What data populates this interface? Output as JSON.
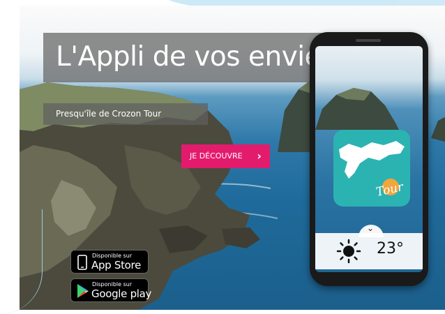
{
  "hero": {
    "headline": "L'Appli de vos envies !",
    "subtitle": "Presqu'île de Crozon Tour",
    "cta_label": "JE DÉCOUVRE",
    "cta_chevron": "›"
  },
  "phone": {
    "app_tile_text": "Tour",
    "temperature": "23°",
    "handle_glyph": "⌄"
  },
  "stores": {
    "apple_small": "Disponible sur",
    "apple_big": "App Store",
    "google_small": "Disponible sur",
    "google_big": "Google play"
  },
  "colors": {
    "cta": "#e31b6d",
    "app_tile": "#2bb3b2"
  },
  "icons": [
    "chevron-right-icon",
    "sun-icon",
    "apple-icon",
    "google-play-icon"
  ]
}
